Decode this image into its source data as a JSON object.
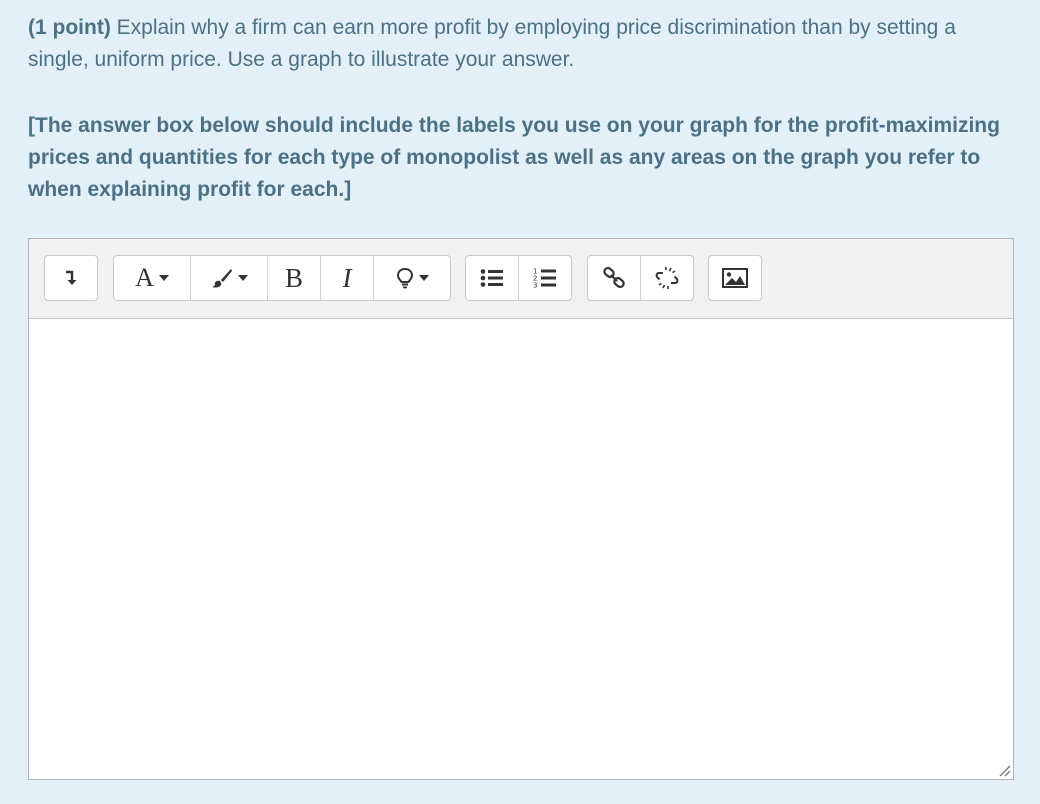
{
  "question": {
    "points": "(1 point)",
    "text": " Explain why a firm can earn more profit by employing price discrimination than by setting a single, uniform price. Use a graph to illustrate your answer."
  },
  "instructions": "[The answer box below should include the labels you use on your graph for the profit-maximizing prices and quantities for each type of monopolist as well as any areas on the graph you refer to when explaining profit for each.]",
  "toolbar": {
    "font_label": "A",
    "bold_label": "B",
    "italic_label": "I",
    "icons": [
      "show-more-icon",
      "font-family-icon",
      "brush-icon",
      "bold-icon",
      "italic-icon",
      "lightbulb-icon",
      "bullet-list-icon",
      "numbered-list-icon",
      "link-icon",
      "unlink-icon",
      "image-icon"
    ]
  },
  "answer": {
    "value": ""
  }
}
